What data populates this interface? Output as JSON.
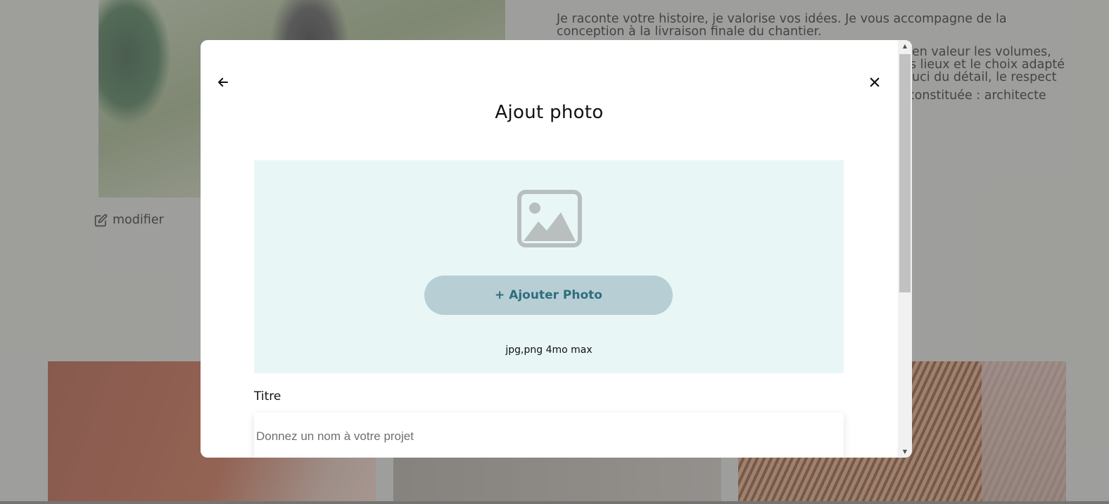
{
  "background": {
    "intro_text": [
      "Je raconte votre histoire, je valorise vos idées. Je vous accompagne de la conception à la livraison finale du chantier.",
      "en valeur les volumes, s lieux et le choix adapté uci du détail, le respect",
      "constituée : architecte"
    ],
    "modifier_label": "modifier",
    "modifier_icon": "edit-icon"
  },
  "modal": {
    "title": "Ajout photo",
    "back_icon": "arrow-left-icon",
    "close_icon": "close-icon",
    "upload": {
      "placeholder_icon": "image-icon",
      "button_label": "+ Ajouter Photo",
      "hint": "jpg,png 4mo max"
    },
    "title_field": {
      "label": "Titre",
      "placeholder": "Donnez un nom à votre projet",
      "value": ""
    }
  },
  "colors": {
    "upload_zone_bg": "#e8f6f6",
    "button_bg": "#b7cfd4",
    "button_text": "#306d7e",
    "image_icon": "#b9bfbf"
  }
}
